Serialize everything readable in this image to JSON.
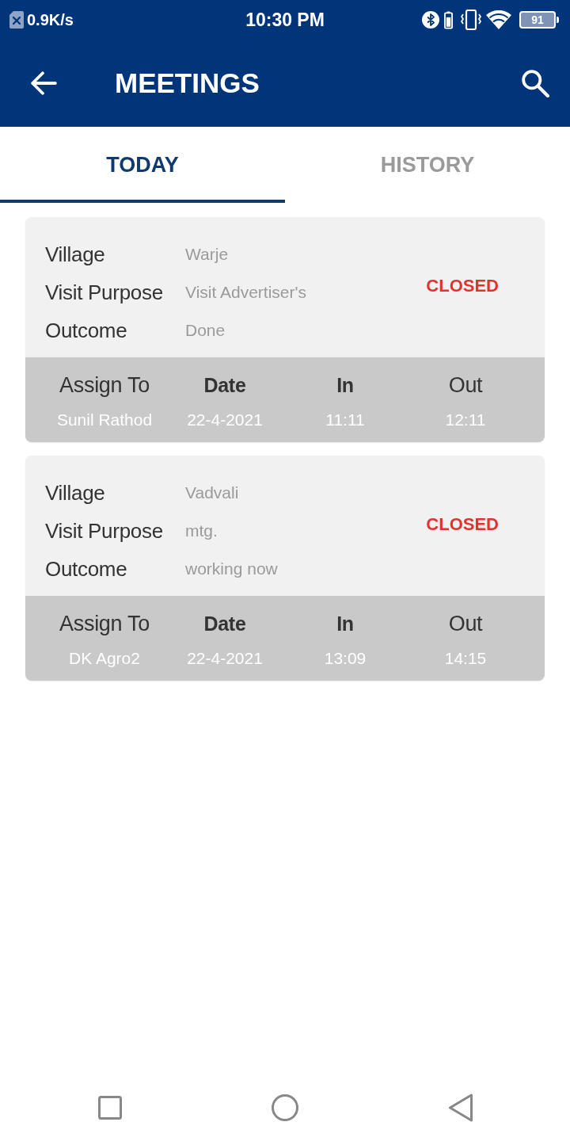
{
  "status_bar": {
    "network_speed": "0.9K/s",
    "time": "10:30 PM",
    "battery": "91"
  },
  "app_bar": {
    "title": "MEETINGS"
  },
  "tabs": [
    {
      "label": "TODAY",
      "selected": true
    },
    {
      "label": "HISTORY",
      "selected": false
    }
  ],
  "meetings": [
    {
      "fields": [
        {
          "label": "Village",
          "value": "Warje"
        },
        {
          "label": "Visit Purpose",
          "value": "Visit Advertiser's"
        },
        {
          "label": "Outcome",
          "value": "Done"
        }
      ],
      "status": "CLOSED",
      "columns": [
        {
          "header": "Assign To",
          "bold": false,
          "value": "Sunil Rathod"
        },
        {
          "header": "Date",
          "bold": true,
          "value": "22-4-2021"
        },
        {
          "header": "In",
          "bold": true,
          "value": "11:11"
        },
        {
          "header": "Out",
          "bold": false,
          "value": "12:11"
        }
      ]
    },
    {
      "fields": [
        {
          "label": "Village",
          "value": "Vadvali"
        },
        {
          "label": "Visit Purpose",
          "value": "mtg."
        },
        {
          "label": "Outcome",
          "value": "working now"
        }
      ],
      "status": "CLOSED",
      "columns": [
        {
          "header": "Assign To",
          "bold": false,
          "value": "DK Agro2"
        },
        {
          "header": "Date",
          "bold": true,
          "value": "22-4-2021"
        },
        {
          "header": "In",
          "bold": true,
          "value": "13:09"
        },
        {
          "header": "Out",
          "bold": false,
          "value": "14:15"
        }
      ]
    }
  ]
}
